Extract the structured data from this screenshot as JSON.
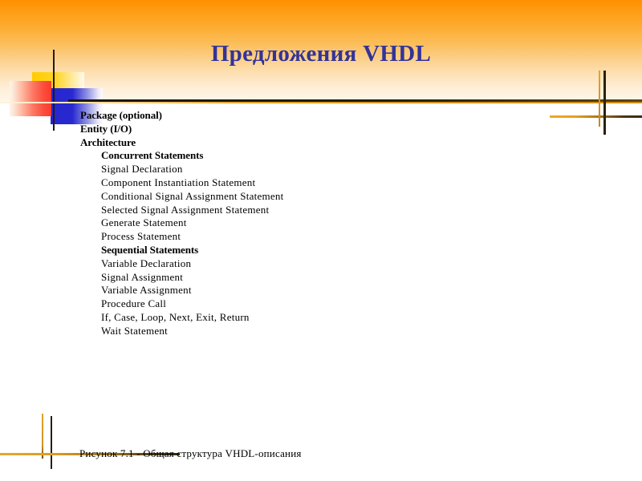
{
  "slide": {
    "title": "Предложения VHDL",
    "caption": "Рисунок  7.1 - Общая структура VHDL-описания"
  },
  "colors": {
    "header_gradient_top": "#ff9000",
    "header_gradient_bottom": "#fff7ea",
    "title_text": "#333399",
    "divider_dark": "#241b0d",
    "divider_orange": "#d9941c",
    "deco_yellow": "#ffcc00",
    "deco_blue": "#2626cc",
    "deco_red": "#fb3b2d",
    "body_text": "#000000"
  },
  "body_list": [
    {
      "text": "Package (optional)",
      "level": 1,
      "bold": true
    },
    {
      "text": "Entity (I/O)",
      "level": 1,
      "bold": true
    },
    {
      "text": "Architecture",
      "level": 1,
      "bold": true
    },
    {
      "text": "Concurrent Statements",
      "level": 2,
      "bold": true
    },
    {
      "text": "Signal Declaration",
      "level": 2,
      "bold": false
    },
    {
      "text": "Component Instantiation Statement",
      "level": 2,
      "bold": false
    },
    {
      "text": "Conditional Signal Assignment Statement",
      "level": 2,
      "bold": false
    },
    {
      "text": "Selected Signal Assignment Statement",
      "level": 2,
      "bold": false
    },
    {
      "text": "Generate Statement",
      "level": 2,
      "bold": false
    },
    {
      "text": "Process Statement",
      "level": 2,
      "bold": false
    },
    {
      "text": "Sequential Statements",
      "level": 2,
      "bold": true
    },
    {
      "text": "Variable Declaration",
      "level": 2,
      "bold": false
    },
    {
      "text": "Signal Assignment",
      "level": 2,
      "bold": false
    },
    {
      "text": "Variable Assignment",
      "level": 2,
      "bold": false
    },
    {
      "text": "Procedure Call",
      "level": 2,
      "bold": false
    },
    {
      "text": "If, Case, Loop, Next, Exit, Return",
      "level": 2,
      "bold": false
    },
    {
      "text": "Wait Statement",
      "level": 2,
      "bold": false
    }
  ]
}
